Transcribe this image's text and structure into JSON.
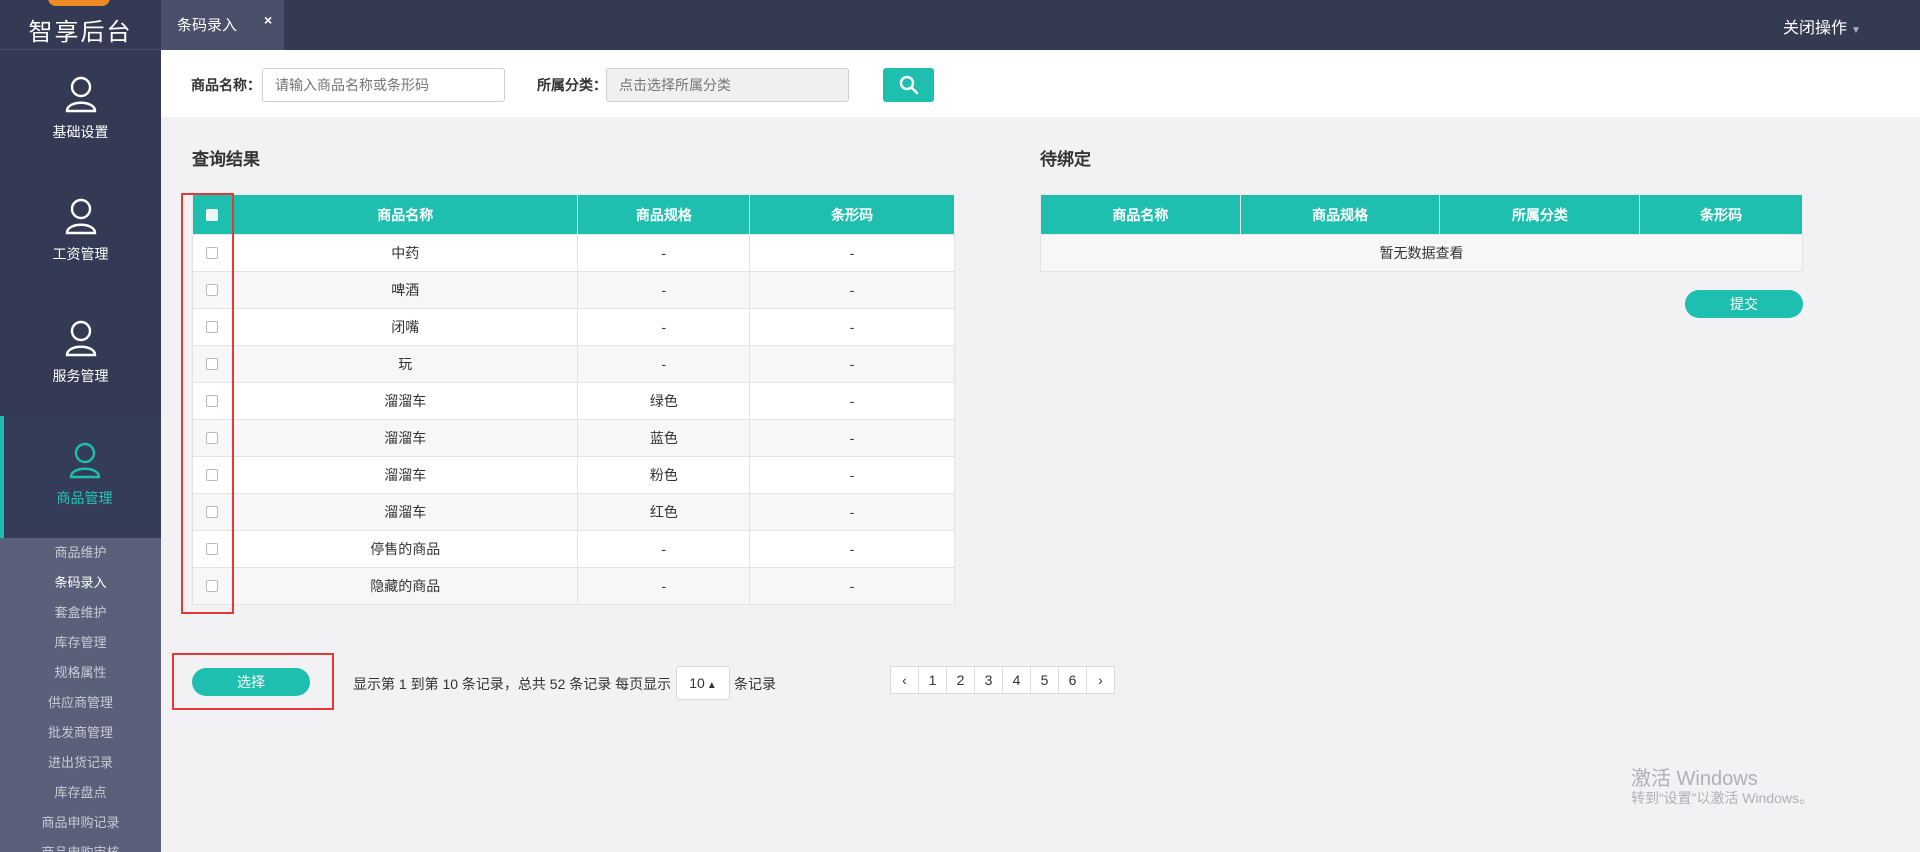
{
  "app": {
    "logo_text": "智享后台",
    "colors": {
      "sidebar": "#343a54",
      "accent": "#1ebfae",
      "topbar": "#353a53",
      "alert": "#e53935"
    }
  },
  "sidebar": {
    "nav": [
      {
        "label": "基础设置",
        "icon": "user-icon"
      },
      {
        "label": "工资管理",
        "icon": "user-icon"
      },
      {
        "label": "服务管理",
        "icon": "user-icon"
      },
      {
        "label": "商品管理",
        "icon": "user-icon",
        "active": true
      }
    ],
    "subnav": [
      {
        "label": "商品维护"
      },
      {
        "label": "条码录入",
        "active": true
      },
      {
        "label": "套盒维护"
      },
      {
        "label": "库存管理"
      },
      {
        "label": "规格属性"
      },
      {
        "label": "供应商管理"
      },
      {
        "label": "批发商管理"
      },
      {
        "label": "进出货记录"
      },
      {
        "label": "库存盘点"
      },
      {
        "label": "商品申购记录"
      },
      {
        "label": "商品申购审核"
      }
    ]
  },
  "topbar": {
    "tab_label": "条码录入",
    "tab_close": "×",
    "close_ops": "关闭操作"
  },
  "search": {
    "name_label": "商品名称：",
    "name_placeholder": "请输入商品名称或条形码",
    "category_label": "所属分类：",
    "category_placeholder": "点击选择所属分类"
  },
  "results": {
    "title": "查询结果",
    "columns": [
      "商品名称",
      "商品规格",
      "条形码"
    ],
    "rows": [
      {
        "name": "中药",
        "spec": "-",
        "barcode": "-"
      },
      {
        "name": "啤酒",
        "spec": "-",
        "barcode": "-"
      },
      {
        "name": "闭嘴",
        "spec": "-",
        "barcode": "-"
      },
      {
        "name": "玩",
        "spec": "-",
        "barcode": "-"
      },
      {
        "name": "溜溜车",
        "spec": "绿色",
        "barcode": "-"
      },
      {
        "name": "溜溜车",
        "spec": "蓝色",
        "barcode": "-"
      },
      {
        "name": "溜溜车",
        "spec": "粉色",
        "barcode": "-"
      },
      {
        "name": "溜溜车",
        "spec": "红色",
        "barcode": "-"
      },
      {
        "name": "停售的商品",
        "spec": "-",
        "barcode": "-"
      },
      {
        "name": "隐藏的商品",
        "spec": "-",
        "barcode": "-"
      }
    ],
    "pager_info": "显示第 1 到第 10 条记录，总共 52 条记录 每页显示",
    "page_size": "10",
    "records_suffix": "条记录",
    "pages": [
      "‹",
      "1",
      "2",
      "3",
      "4",
      "5",
      "6",
      "›"
    ],
    "select_button": "选择"
  },
  "pending": {
    "title": "待绑定",
    "columns": [
      "商品名称",
      "商品规格",
      "所属分类",
      "条形码"
    ],
    "empty_text": "暂无数据查看",
    "submit_button": "提交"
  },
  "watermark": {
    "line1": "激活 Windows",
    "line2": "转到“设置”以激活 Windows。"
  }
}
